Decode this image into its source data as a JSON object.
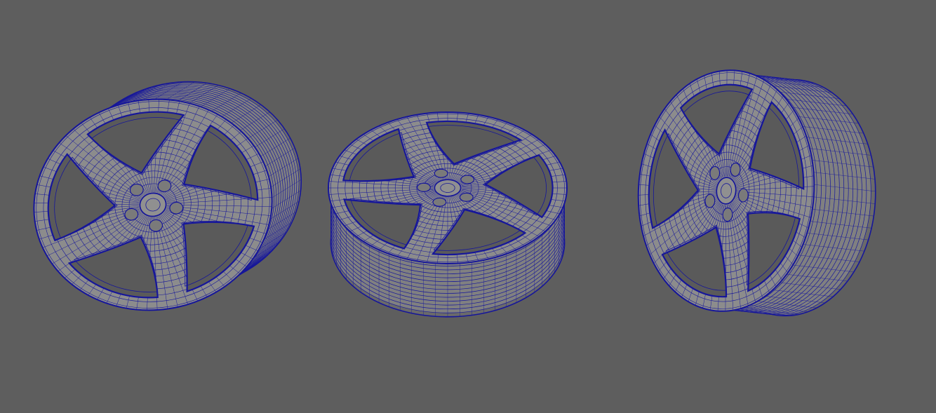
{
  "viewport": {
    "background": "#5e5e5e",
    "wire_color": "#16169a",
    "surface_color": "#8c8c8c",
    "shadow_color": "#4a4a4a"
  },
  "objects": [
    {
      "type": "wheel-rim-wireframe",
      "view": "front-left",
      "spokes": 5,
      "lug_nuts": 5
    },
    {
      "type": "wheel-rim-wireframe",
      "view": "top-tilted",
      "spokes": 5,
      "lug_nuts": 5
    },
    {
      "type": "wheel-rim-wireframe",
      "view": "front-right",
      "spokes": 5,
      "lug_nuts": 5
    }
  ]
}
